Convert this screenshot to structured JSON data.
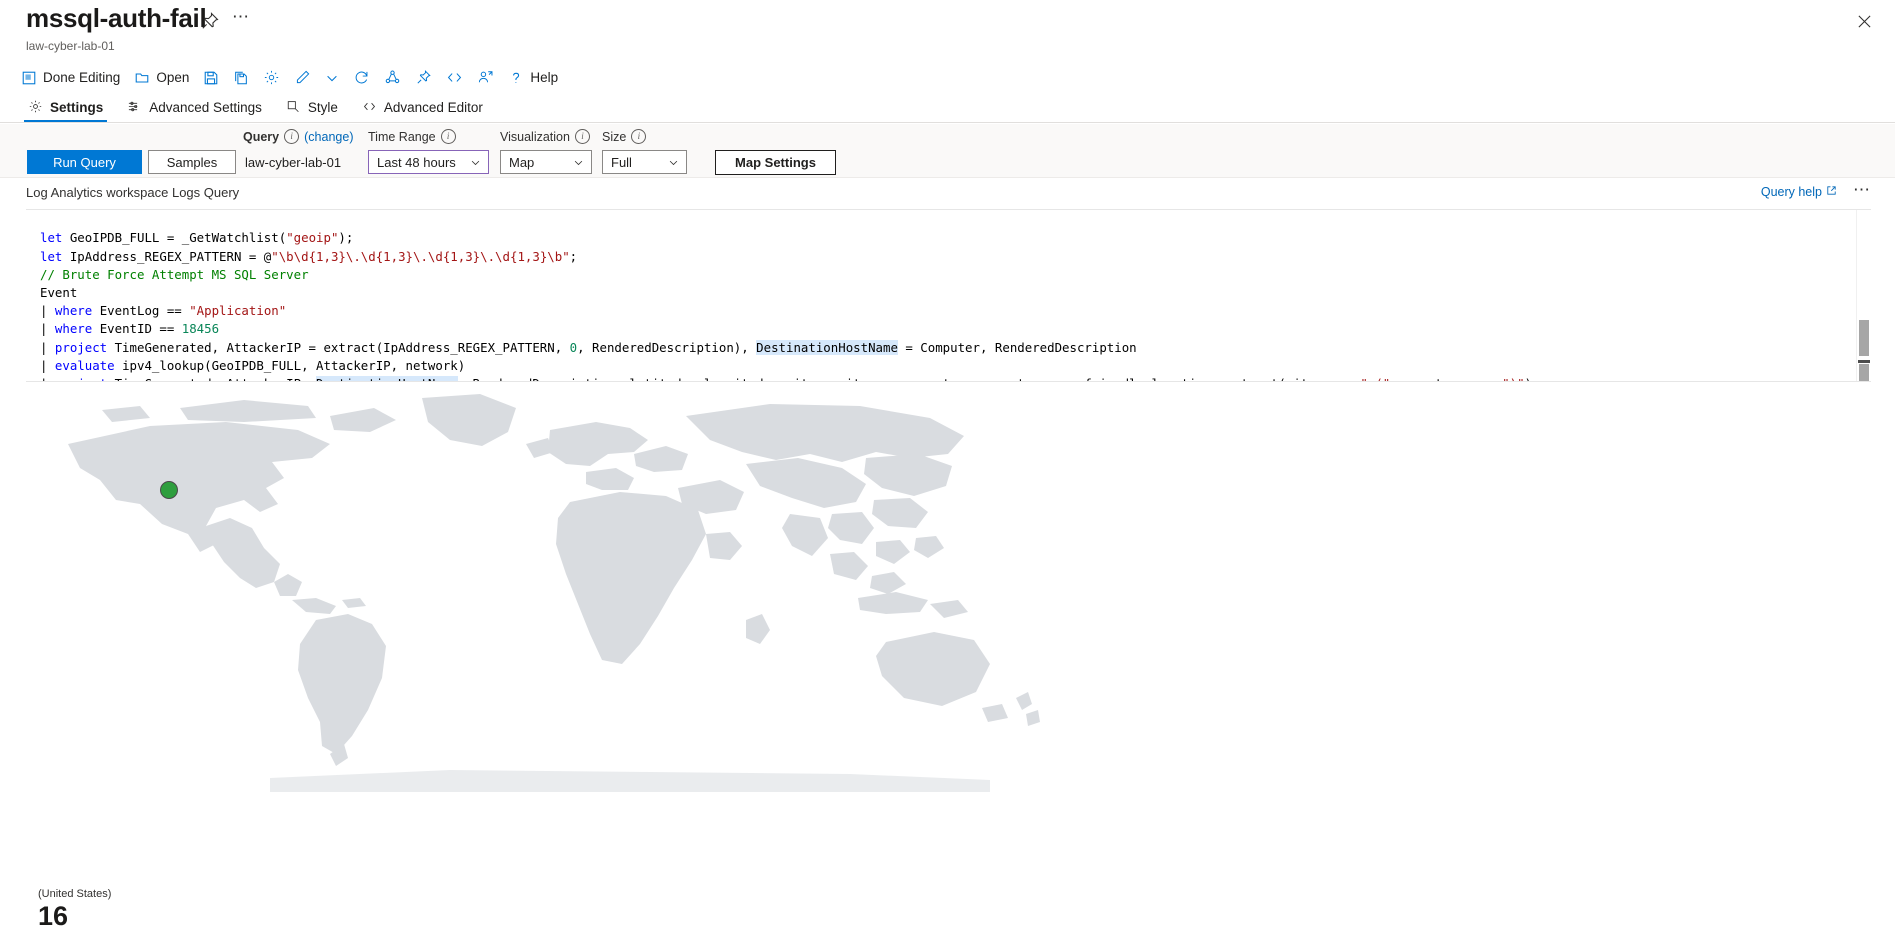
{
  "header": {
    "title": "mssql-auth-fail",
    "subtitle": "law-cyber-lab-01",
    "pin_icon": "pin-icon",
    "more_icon": "ellipsis-icon",
    "close_icon": "close-icon"
  },
  "commandbar": {
    "items": [
      {
        "label": "Done Editing",
        "icon": "done-editing-icon"
      },
      {
        "label": "Open",
        "icon": "folder-open-icon"
      },
      {
        "label": "",
        "icon": "save-icon"
      },
      {
        "label": "",
        "icon": "save-as-icon"
      },
      {
        "label": "",
        "icon": "settings-gear-icon"
      },
      {
        "label": "",
        "icon": "edit-pencil-icon"
      },
      {
        "label": "",
        "icon": "chevron-down-icon"
      },
      {
        "label": "",
        "icon": "refresh-icon"
      },
      {
        "label": "",
        "icon": "share-icon"
      },
      {
        "label": "",
        "icon": "pin-icon"
      },
      {
        "label": "",
        "icon": "code-icon"
      },
      {
        "label": "",
        "icon": "assign-user-icon"
      },
      {
        "label": "Help",
        "icon": "help-question-icon"
      }
    ]
  },
  "tabs": [
    {
      "label": "Settings",
      "icon": "gear-icon",
      "selected": true
    },
    {
      "label": "Advanced Settings",
      "icon": "sliders-icon",
      "selected": false
    },
    {
      "label": "Style",
      "icon": "style-icon",
      "selected": false
    },
    {
      "label": "Advanced Editor",
      "icon": "code-icon",
      "selected": false
    }
  ],
  "query_settings": {
    "run_query_label": "Run Query",
    "samples_label": "Samples",
    "query_label": "Query",
    "change_link": "(change)",
    "workspace_value": "law-cyber-lab-01",
    "time_range_label": "Time Range",
    "time_range_value": "Last 48 hours",
    "visualization_label": "Visualization",
    "visualization_value": "Map",
    "size_label": "Size",
    "size_value": "Full",
    "map_settings_label": "Map Settings"
  },
  "query_editor": {
    "section_label": "Log Analytics workspace Logs Query",
    "query_help_label": "Query help",
    "query_help_icon": "external-link-icon",
    "more_icon": "ellipsis-icon",
    "lines": [
      "let GeoIPDB_FULL = _GetWatchlist(\"geoip\");",
      "let IpAddress_REGEX_PATTERN = @\"\\b\\d{1,3}\\.\\d{1,3}\\.\\d{1,3}\\.\\d{1,3}\\b\";",
      "// Brute Force Attempt MS SQL Server",
      "Event",
      "| where EventLog == \"Application\"",
      "| where EventID == 18456",
      "| project TimeGenerated, AttackerIP = extract(IpAddress_REGEX_PATTERN, 0, RenderedDescription), DestinationHostName = Computer, RenderedDescription",
      "| evaluate ipv4_lookup(GeoIPDB_FULL, AttackerIP, network)",
      "| project TimeGenerated, AttackerIP, DestinationHostName, RenderedDescription, latitude, longitude, city = cityname, country = countryname, friendly_location = strcat(cityname, \" (\", countryname, \")\");"
    ]
  },
  "map": {
    "marker_color": "#2e9e3e",
    "marker_border_color": "#4a4a4a",
    "land_color": "#d9dce0",
    "legend_caption": "(United States)",
    "legend_value": "16"
  },
  "colors": {
    "accent": "#0078d4",
    "link": "#0067b8",
    "focus_border": "#8764b8",
    "strip_bg": "#faf9f8"
  }
}
